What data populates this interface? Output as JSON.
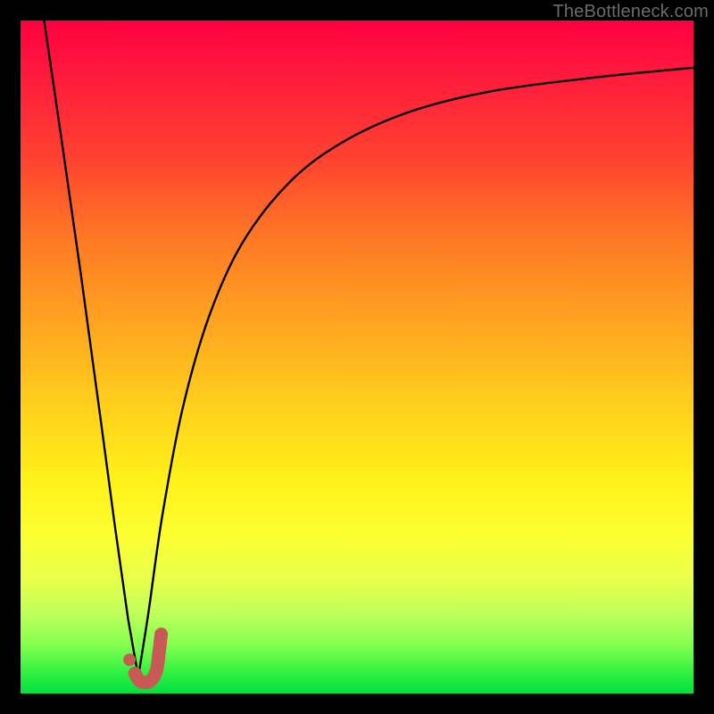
{
  "watermark": "TheBottleneck.com",
  "colors": {
    "frame": "#000000",
    "curve": "#000000",
    "marker_stroke": "#c75a55",
    "marker_fill": "#c75a55",
    "gradient_top": "#ff0040",
    "gradient_mid": "#fff018",
    "gradient_bottom": "#00e040"
  },
  "chart_data": {
    "type": "line",
    "title": "",
    "xlabel": "",
    "ylabel": "",
    "xlim": [
      0,
      100
    ],
    "ylim": [
      0,
      100
    ],
    "grid": false,
    "note": "x and y are percentages of the plotting rectangle (left→right, bottom→top). Values estimated from pixels.",
    "series": [
      {
        "name": "left-descent",
        "x": [
          3.5,
          6,
          9,
          12,
          14,
          16,
          17.5
        ],
        "y": [
          100,
          83,
          62,
          40,
          25,
          11,
          2.5
        ]
      },
      {
        "name": "right-ascent",
        "x": [
          17.5,
          19,
          21,
          24,
          28,
          33,
          40,
          48,
          58,
          70,
          85,
          100
        ],
        "y": [
          2.5,
          12,
          26,
          42,
          56,
          67,
          76,
          82,
          86.5,
          89.5,
          91.5,
          93
        ]
      }
    ],
    "marker": {
      "name": "J-marker",
      "dot": {
        "x": 16.2,
        "y": 5.0
      },
      "hook": [
        {
          "x": 17.0,
          "y": 3.0
        },
        {
          "x": 17.8,
          "y": 1.8
        },
        {
          "x": 19.2,
          "y": 1.8
        },
        {
          "x": 20.2,
          "y": 3.4
        },
        {
          "x": 20.6,
          "y": 6.2
        },
        {
          "x": 20.9,
          "y": 8.8
        }
      ]
    }
  }
}
